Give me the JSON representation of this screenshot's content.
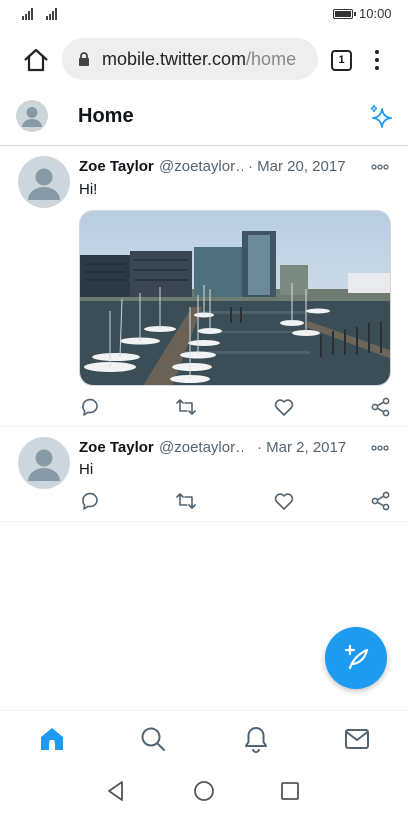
{
  "status_bar": {
    "time": "10:00"
  },
  "browser": {
    "url_host": "mobile.twitter.com",
    "url_path": "/home",
    "tab_count": "1"
  },
  "header": {
    "title": "Home"
  },
  "tweets": [
    {
      "name": "Zoe Taylor",
      "handle": "@zoetaylor…",
      "date": "· Mar 20, 2017",
      "text": "Hi!",
      "has_image": true,
      "image_icon": "harbor-photo"
    },
    {
      "name": "Zoe Taylor",
      "handle": "@zoetaylor…",
      "date": "· Mar 2, 2017",
      "text": "Hi",
      "has_image": false
    }
  ],
  "bottom_nav": [
    "home-icon",
    "search-icon",
    "notifications-icon",
    "messages-icon"
  ],
  "colors": {
    "accent": "#1d9bf0",
    "text": "#0f1419",
    "muted": "#536471",
    "border": "#cfd9de"
  }
}
